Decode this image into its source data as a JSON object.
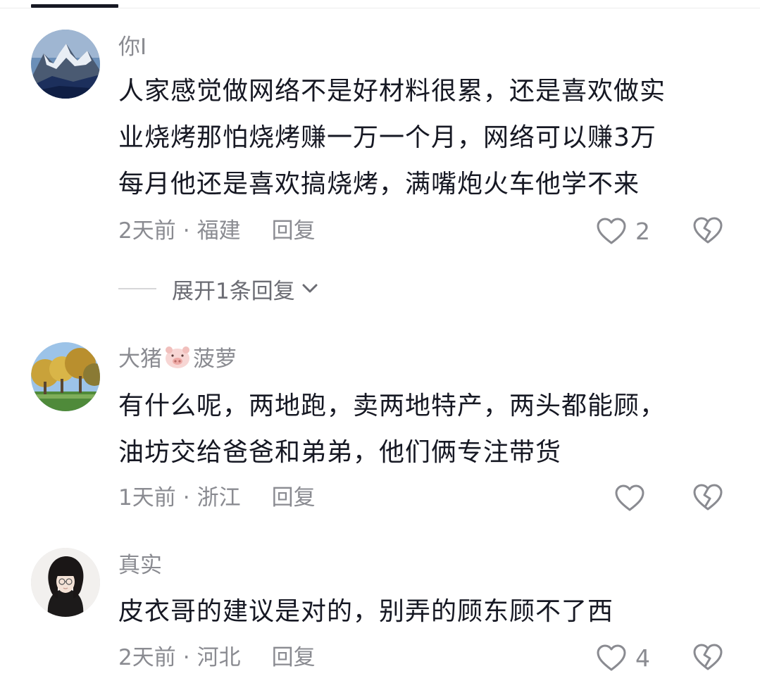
{
  "comments": [
    {
      "username": "你I",
      "text_lines": [
        "人家感觉做网络不是好材料很累，还是喜欢做实",
        "业烧烤那怕烧烤赚一万一个月，网络可以赚3万",
        "每月他还是喜欢搞烧烤，满嘴炮火车他学不来"
      ],
      "time": "2天前",
      "separator": "·",
      "location": "福建",
      "reply_label": "回复",
      "like_count": "2",
      "like_icon": "heart-outline-icon",
      "dislike_icon": "broken-heart-icon",
      "avatar_icon": "mountain-avatar"
    },
    {
      "username_prefix": "大猪",
      "username_suffix": "菠萝",
      "username_emoji": "pig-face-icon",
      "text_lines": [
        "有什么呢，两地跑，卖两地特产，两头都能顾，",
        "油坊交给爸爸和弟弟，他们俩专注带货"
      ],
      "time": "1天前",
      "separator": "·",
      "location": "浙江",
      "reply_label": "回复",
      "like_count": "",
      "like_icon": "heart-outline-icon",
      "dislike_icon": "broken-heart-icon",
      "avatar_icon": "autumn-trees-avatar"
    },
    {
      "username": "真实",
      "text_lines": [
        "皮衣哥的建议是对的，别弄的顾东顾不了西"
      ],
      "time": "2天前",
      "separator": "·",
      "location": "河北",
      "reply_label": "回复",
      "like_count": "4",
      "like_icon": "heart-outline-icon",
      "dislike_icon": "broken-heart-icon",
      "avatar_icon": "girl-portrait-avatar"
    }
  ],
  "expand_replies": {
    "label": "展开1条回复",
    "icon": "chevron-down-icon"
  },
  "colors": {
    "text": "#161823",
    "secondary": "#8a8b91",
    "icon": "#8a8b91"
  }
}
